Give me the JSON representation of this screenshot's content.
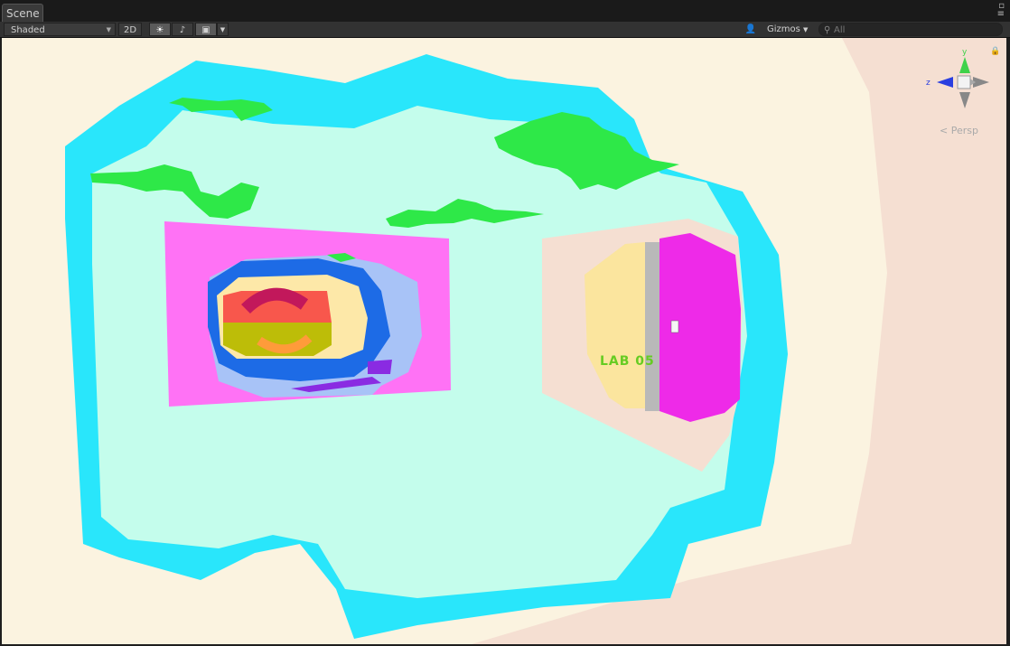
{
  "window": {
    "tab_label": "Scene"
  },
  "toolbar": {
    "draw_mode": "Shaded",
    "mode_2d": "2D",
    "gizmos_label": "Gizmos",
    "search_placeholder": "All"
  },
  "orientation_gizmo": {
    "axis_y": "y",
    "axis_z": "z",
    "projection": "Persp"
  },
  "scene": {
    "door_sign": "LAB 05",
    "colors": {
      "frame": "#29e6fb",
      "floor": "#c4fdec",
      "wall_panel": "#ff72f5",
      "door": "#ee2ae8",
      "outer_wall": "#f5dfd2",
      "foliage": "#2ee848"
    }
  }
}
